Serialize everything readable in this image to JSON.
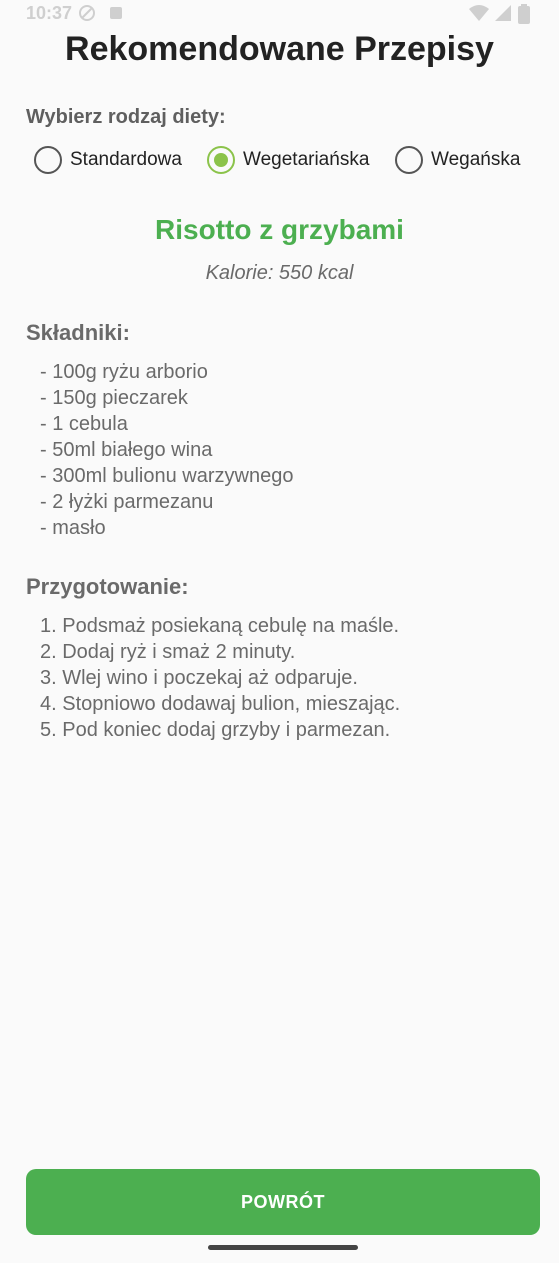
{
  "status_bar": {
    "time": "10:37",
    "icons": [
      "do-not-disturb-icon",
      "notification-icon",
      "wifi-icon",
      "signal-icon",
      "battery-icon"
    ]
  },
  "title": "Rekomendowane Przepisy",
  "diet_selector": {
    "label": "Wybierz rodzaj diety:",
    "options": [
      {
        "label": "Standardowa",
        "checked": false
      },
      {
        "label": "Wegetariańska",
        "checked": true
      },
      {
        "label": "Wegańska",
        "checked": false
      }
    ]
  },
  "recipe": {
    "name": "Risotto z grzybami",
    "calories": "Kalorie: 550 kcal",
    "ingredients_heading": "Składniki:",
    "ingredients": [
      "- 100g ryżu arborio",
      "- 150g pieczarek",
      "- 1 cebula",
      "- 50ml białego wina",
      "- 300ml bulionu warzywnego",
      "- 2 łyżki parmezanu",
      "- masło"
    ],
    "preparation_heading": "Przygotowanie:",
    "steps": [
      "1. Podsmaż posiekaną cebulę na maśle.",
      "2. Dodaj ryż i smaż 2 minuty.",
      "3. Wlej wino i poczekaj aż odparuje.",
      "4. Stopniowo dodawaj bulion, mieszając.",
      "5. Pod koniec dodaj grzyby i parmezan."
    ]
  },
  "back_button": {
    "label": "POWRÓT"
  },
  "colors": {
    "accent": "#4caf50",
    "radio_checked": "#8bc34a",
    "text_muted": "#6a6a6a",
    "title": "#222222"
  }
}
